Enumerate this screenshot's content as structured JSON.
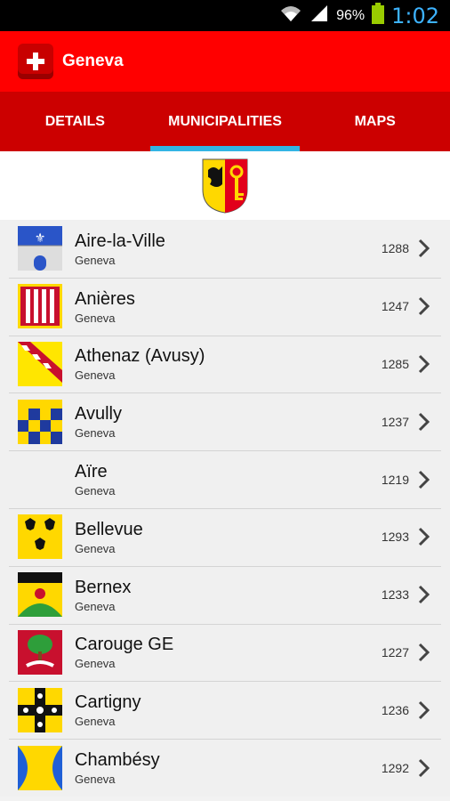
{
  "status": {
    "battery_pct": "96%",
    "time": "1:02"
  },
  "appbar": {
    "title": "Geneva"
  },
  "tabs": [
    {
      "label": "DETAILS"
    },
    {
      "label": "MUNICIPALITIES"
    },
    {
      "label": "MAPS"
    }
  ],
  "items": [
    {
      "name": "Aire-la-Ville",
      "canton": "Geneva",
      "number": "1288",
      "flag": "aire-la-ville-flag"
    },
    {
      "name": "Anières",
      "canton": "Geneva",
      "number": "1247",
      "flag": "anieres-flag"
    },
    {
      "name": "Athenaz (Avusy)",
      "canton": "Geneva",
      "number": "1285",
      "flag": "athenaz-flag"
    },
    {
      "name": "Avully",
      "canton": "Geneva",
      "number": "1237",
      "flag": "avully-flag"
    },
    {
      "name": "Aïre",
      "canton": "Geneva",
      "number": "1219",
      "flag": ""
    },
    {
      "name": "Bellevue",
      "canton": "Geneva",
      "number": "1293",
      "flag": "bellevue-flag"
    },
    {
      "name": "Bernex",
      "canton": "Geneva",
      "number": "1233",
      "flag": "bernex-flag"
    },
    {
      "name": "Carouge GE",
      "canton": "Geneva",
      "number": "1227",
      "flag": "carouge-flag"
    },
    {
      "name": "Cartigny",
      "canton": "Geneva",
      "number": "1236",
      "flag": "cartigny-flag"
    },
    {
      "name": "Chambésy",
      "canton": "Geneva",
      "number": "1292",
      "flag": "chambesy-flag"
    }
  ]
}
